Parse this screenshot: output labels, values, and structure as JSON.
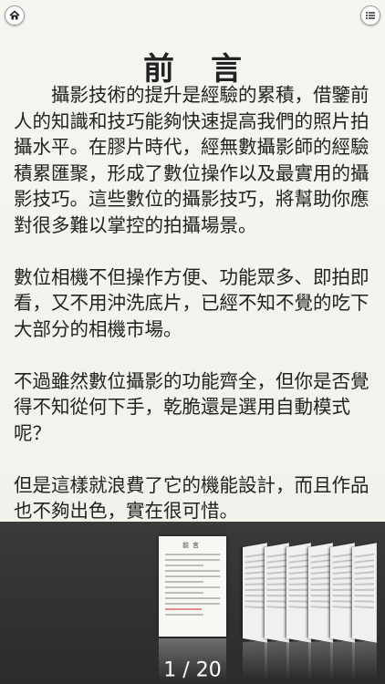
{
  "header": {
    "home_icon": "home-icon",
    "menu_icon": "list-icon"
  },
  "document": {
    "title": "前言",
    "paragraphs": [
      "攝影技術的提升是經驗的累積，借鑒前人的知識和技巧能夠快速提高我們的照片拍攝水平。在膠片時代，經無數攝影師的經驗積累匯聚，形成了數位操作以及最實用的攝影技巧。這些數位的攝影技巧，將幫助你應對很多難以掌控的拍攝場景。",
      "數位相機不但操作方便、功能眾多、即拍即看，又不用沖洗底片，已經不知不覺的吃下大部分的相機市場。",
      "不過雖然數位攝影的功能齊全，但你是否覺得不知從何下手，乾脆還是選用自動模式呢？",
      "但是這樣就浪費了它的機能設計，而且作品也不夠出色，實在很可惜。"
    ]
  },
  "thumbnails": {
    "current_title": "前言",
    "page_indicator": "1 / 20"
  }
}
